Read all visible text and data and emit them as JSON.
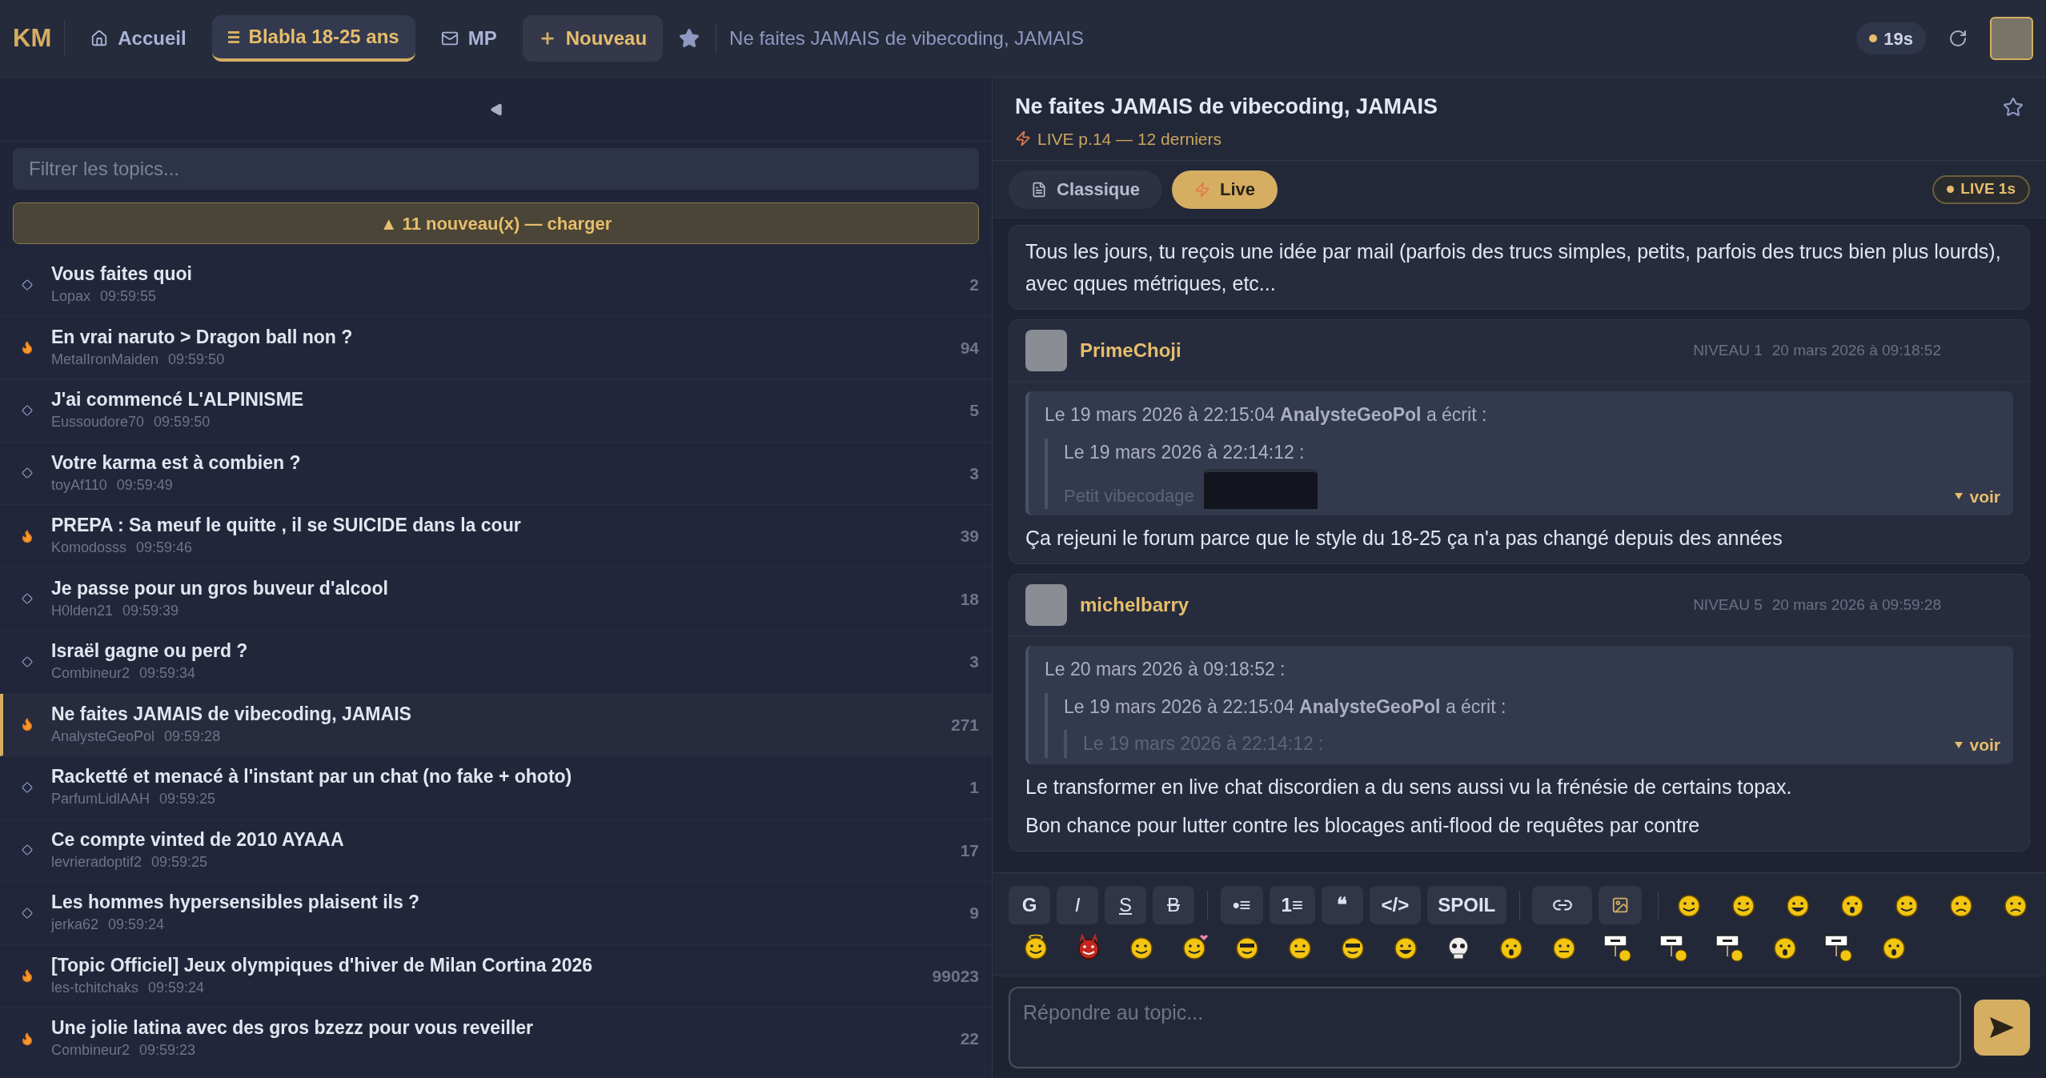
{
  "topbar": {
    "logo": "KM",
    "nav": [
      {
        "kind": "home",
        "label": "Accueil",
        "selected": false
      },
      {
        "kind": "list",
        "label": "Blabla 18-25 ans",
        "selected": true
      },
      {
        "kind": "mail",
        "label": "MP",
        "selected": false
      },
      {
        "kind": "plus",
        "label": "Nouveau",
        "selected": false
      }
    ],
    "breadcrumb": "Ne faites JAMAIS de vibecoding, JAMAIS",
    "timer": "19s"
  },
  "sidebar": {
    "filter": {
      "placeholder": "Filtrer les topics..."
    },
    "banner": "▲ 11 nouveau(x) — charger",
    "topics": [
      {
        "title": "Vous faites quoi",
        "author": "Lopax",
        "time": "09:59:55",
        "count": "2",
        "hot": false,
        "selected": false
      },
      {
        "title": "En vrai naruto > Dragon ball non ?",
        "author": "MetalIronMaiden",
        "time": "09:59:50",
        "count": "94",
        "hot": true,
        "selected": false
      },
      {
        "title": "J'ai commencé L'ALPINISME",
        "author": "Eussoudore70",
        "time": "09:59:50",
        "count": "5",
        "hot": false,
        "selected": false
      },
      {
        "title": "Votre karma est à combien ?",
        "author": "toyAf110",
        "time": "09:59:49",
        "count": "3",
        "hot": false,
        "selected": false
      },
      {
        "title": "PREPA : Sa meuf le quitte , il se SUICIDE dans la cour",
        "author": "Komodosss",
        "time": "09:59:46",
        "count": "39",
        "hot": true,
        "selected": false
      },
      {
        "title": "Je passe pour un gros buveur d'alcool",
        "author": "H0lden21",
        "time": "09:59:39",
        "count": "18",
        "hot": false,
        "selected": false
      },
      {
        "title": "Israël gagne ou perd ?",
        "author": "Combineur2",
        "time": "09:59:34",
        "count": "3",
        "hot": false,
        "selected": false
      },
      {
        "title": "Ne faites JAMAIS de vibecoding, JAMAIS",
        "author": "AnalysteGeoPol",
        "time": "09:59:28",
        "count": "271",
        "hot": true,
        "selected": true
      },
      {
        "title": "Racketté et menacé à l'instant par un chat (no fake + ohoto)",
        "author": "ParfumLidlAAH",
        "time": "09:59:25",
        "count": "1",
        "hot": false,
        "selected": false
      },
      {
        "title": "Ce compte vinted de 2010 AYAAA",
        "author": "levrieradoptif2",
        "time": "09:59:25",
        "count": "17",
        "hot": false,
        "selected": false
      },
      {
        "title": "Les hommes hypersensibles plaisent ils ?",
        "author": "jerka62",
        "time": "09:59:24",
        "count": "9",
        "hot": false,
        "selected": false
      },
      {
        "title": "[Topic Officiel] Jeux olympiques d'hiver de Milan Cortina 2026",
        "author": "les-tchitchaks",
        "time": "09:59:24",
        "count": "99023",
        "hot": true,
        "selected": false
      },
      {
        "title": "Une jolie latina avec des gros bzezz pour vous reveiller",
        "author": "Combineur2",
        "time": "09:59:23",
        "count": "22",
        "hot": true,
        "selected": false
      }
    ]
  },
  "topic": {
    "title": "Ne faites JAMAIS de vibecoding, JAMAIS",
    "subtitle": "LIVE p.14 — 12 derniers",
    "tabs": [
      {
        "kind": "doc",
        "label": "Classique",
        "selected": false
      },
      {
        "kind": "live",
        "label": "Live",
        "selected": true
      }
    ],
    "live_badge": "LIVE 1s",
    "posts": [
      {
        "body": [
          "Tous les jours, tu reçois une idée par mail (parfois des trucs simples, petits, parfois des trucs bien plus lourds), avec qques métriques, etc..."
        ]
      },
      {
        "author": "PrimeChoji",
        "level_label": "NIVEAU 1",
        "date": "20 mars 2026 à 09:18:52",
        "quote": {
          "text": "Le 19 mars 2026 à 22:15:04 **AnalysteGeoPol** a écrit :",
          "quote": {
            "text": "Le 19 mars 2026 à 22:14:12 :",
            "screenshot": true,
            "faded": "Petit vibecodage"
          }
        },
        "more": "voir",
        "body": [
          "Ça rejeuni le forum parce que le style du 18-25 ça n'a pas changé depuis des années"
        ]
      },
      {
        "author": "michelbarry",
        "level_label": "NIVEAU 5",
        "date": "20 mars 2026 à 09:59:28",
        "quote": {
          "text": "Le 20 mars 2026 à 09:18:52 :",
          "quote": {
            "text": "Le 19 mars 2026 à 22:15:04 **AnalysteGeoPol** a écrit :",
            "quote": {
              "text": "Le 19 mars 2026 à 22:14:12 :",
              "faded_text": true
            }
          }
        },
        "more": "voir",
        "body": [
          "Le transformer en live chat discordien a du sens aussi vu la frénésie de certains topax.",
          "Bon chance pour lutter contre les blocages anti-flood de requêtes par contre"
        ]
      }
    ]
  },
  "editor": {
    "tools": [
      [
        {
          "kind": "text",
          "label": "G"
        },
        {
          "kind": "italic",
          "label": "I"
        },
        {
          "kind": "underline",
          "label": "S"
        },
        {
          "kind": "strike",
          "label": "B"
        }
      ],
      [
        {
          "kind": "text",
          "label": "•≡"
        },
        {
          "kind": "text",
          "label": "1≡"
        },
        {
          "kind": "text",
          "label": "❝"
        },
        {
          "kind": "text",
          "label": "</>"
        },
        {
          "kind": "text",
          "label": "SPOIL"
        }
      ],
      [
        {
          "kind": "link"
        },
        {
          "kind": "image"
        }
      ]
    ],
    "smileys": [
      {
        "kind": "smile"
      },
      {
        "kind": "smile"
      },
      {
        "kind": "laugh"
      },
      {
        "kind": "surprised"
      },
      {
        "kind": "smile"
      },
      {
        "kind": "sad"
      },
      {
        "kind": "sad"
      },
      {
        "kind": "angel"
      },
      {
        "kind": "devil"
      },
      {
        "kind": "smile"
      },
      {
        "kind": "love"
      },
      {
        "kind": "cool"
      },
      {
        "kind": "wink"
      },
      {
        "kind": "cool"
      },
      {
        "kind": "laugh"
      },
      {
        "kind": "skull"
      },
      {
        "kind": "surprised"
      },
      {
        "kind": "wink"
      },
      {
        "kind": "sign"
      },
      {
        "kind": "sign"
      },
      {
        "kind": "sign"
      },
      {
        "kind": "surprised"
      },
      {
        "kind": "sign"
      },
      {
        "kind": "surprised"
      }
    ],
    "reply": {
      "placeholder": "Répondre au topic..."
    }
  }
}
